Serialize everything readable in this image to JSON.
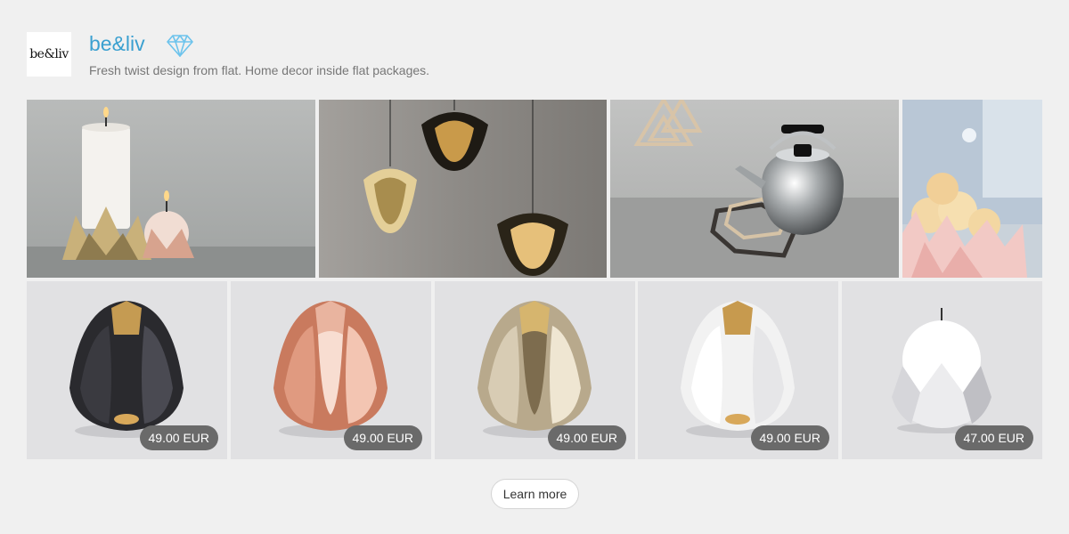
{
  "header": {
    "logo_text": "be&liv",
    "brand_name": "be&liv",
    "tagline": "Fresh twist design from flat. Home decor inside flat packages.",
    "badge_icon": "diamond-icon",
    "accent_color": "#3aa0d0"
  },
  "gallery": {
    "photos": [
      {
        "name": "candle-holders-photo"
      },
      {
        "name": "pendant-lamps-photo"
      },
      {
        "name": "kettle-trivet-photo"
      },
      {
        "name": "fruit-bowl-photo"
      }
    ]
  },
  "products": [
    {
      "name": "black-tealight-holder",
      "price": "49.00 EUR",
      "color": "#2a2a2e"
    },
    {
      "name": "copper-tealight-holder",
      "price": "49.00 EUR",
      "color": "#d9907a"
    },
    {
      "name": "brass-tealight-holder",
      "price": "49.00 EUR",
      "color": "#c9b89a"
    },
    {
      "name": "white-tealight-holder",
      "price": "49.00 EUR",
      "color": "#f4f4f4"
    },
    {
      "name": "white-candle-holder",
      "price": "47.00 EUR",
      "color": "#ffffff"
    }
  ],
  "cta": {
    "learn_more": "Learn more"
  }
}
